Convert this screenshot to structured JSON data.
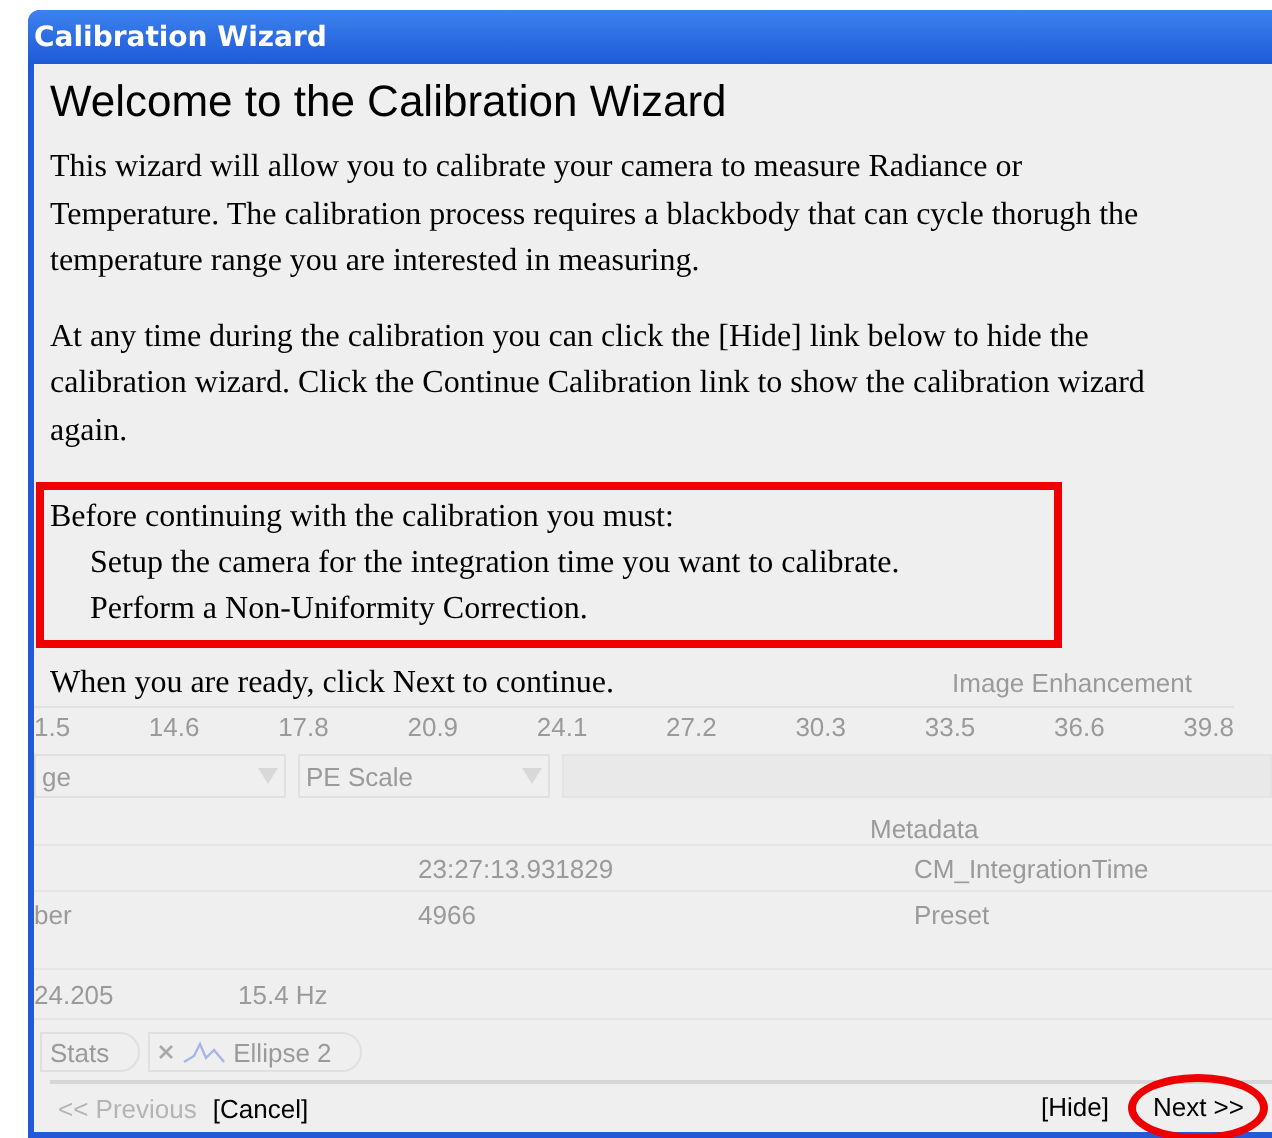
{
  "window": {
    "title": "Calibration Wizard"
  },
  "wizard": {
    "heading": "Welcome to the Calibration Wizard",
    "paragraphs": [
      "This wizard will allow you to calibrate your camera to measure Radiance or Temperature.  The calibration process requires a blackbody that can cycle thorugh the temperature range you are interested in measuring.",
      "At any time during the calibration you can click the [Hide] link below to hide the calibration wizard.  Click the Continue Calibration link to show the calibration wizard again."
    ],
    "requirements": {
      "intro": "Before continuing with the calibration you must:",
      "items": [
        "Setup the camera for the integration time you want to calibrate.",
        "Perform a Non-Uniformity Correction."
      ],
      "highlighted": true
    },
    "closing": "When you are ready, click Next to continue."
  },
  "background": {
    "panel_title": "Image Enhancement",
    "axis_ticks": [
      "1.5",
      "14.6",
      "17.8",
      "20.9",
      "24.1",
      "27.2",
      "30.3",
      "33.5",
      "36.6",
      "39.8"
    ],
    "dropdowns": [
      "ge",
      "PE Scale"
    ],
    "metadata_title": "Metadata",
    "metadata_rows": [
      {
        "value": "23:27:13.931829",
        "field": "CM_IntegrationTime"
      },
      {
        "name": "ber",
        "value": "4966",
        "field": "Preset"
      }
    ],
    "readouts": [
      "24.205",
      "15.4 Hz"
    ],
    "tabs": [
      {
        "label": "Stats",
        "closable": false
      },
      {
        "label": "Ellipse 2",
        "closable": true
      }
    ]
  },
  "footer": {
    "left_buttons": [
      {
        "label": "<< Previous",
        "disabled": true
      },
      {
        "label": "[Cancel]",
        "disabled": false
      }
    ],
    "right_buttons": [
      {
        "label": "[Hide]",
        "disabled": false,
        "circled": false
      },
      {
        "label": "Next >>",
        "disabled": false,
        "circled": true
      }
    ]
  }
}
